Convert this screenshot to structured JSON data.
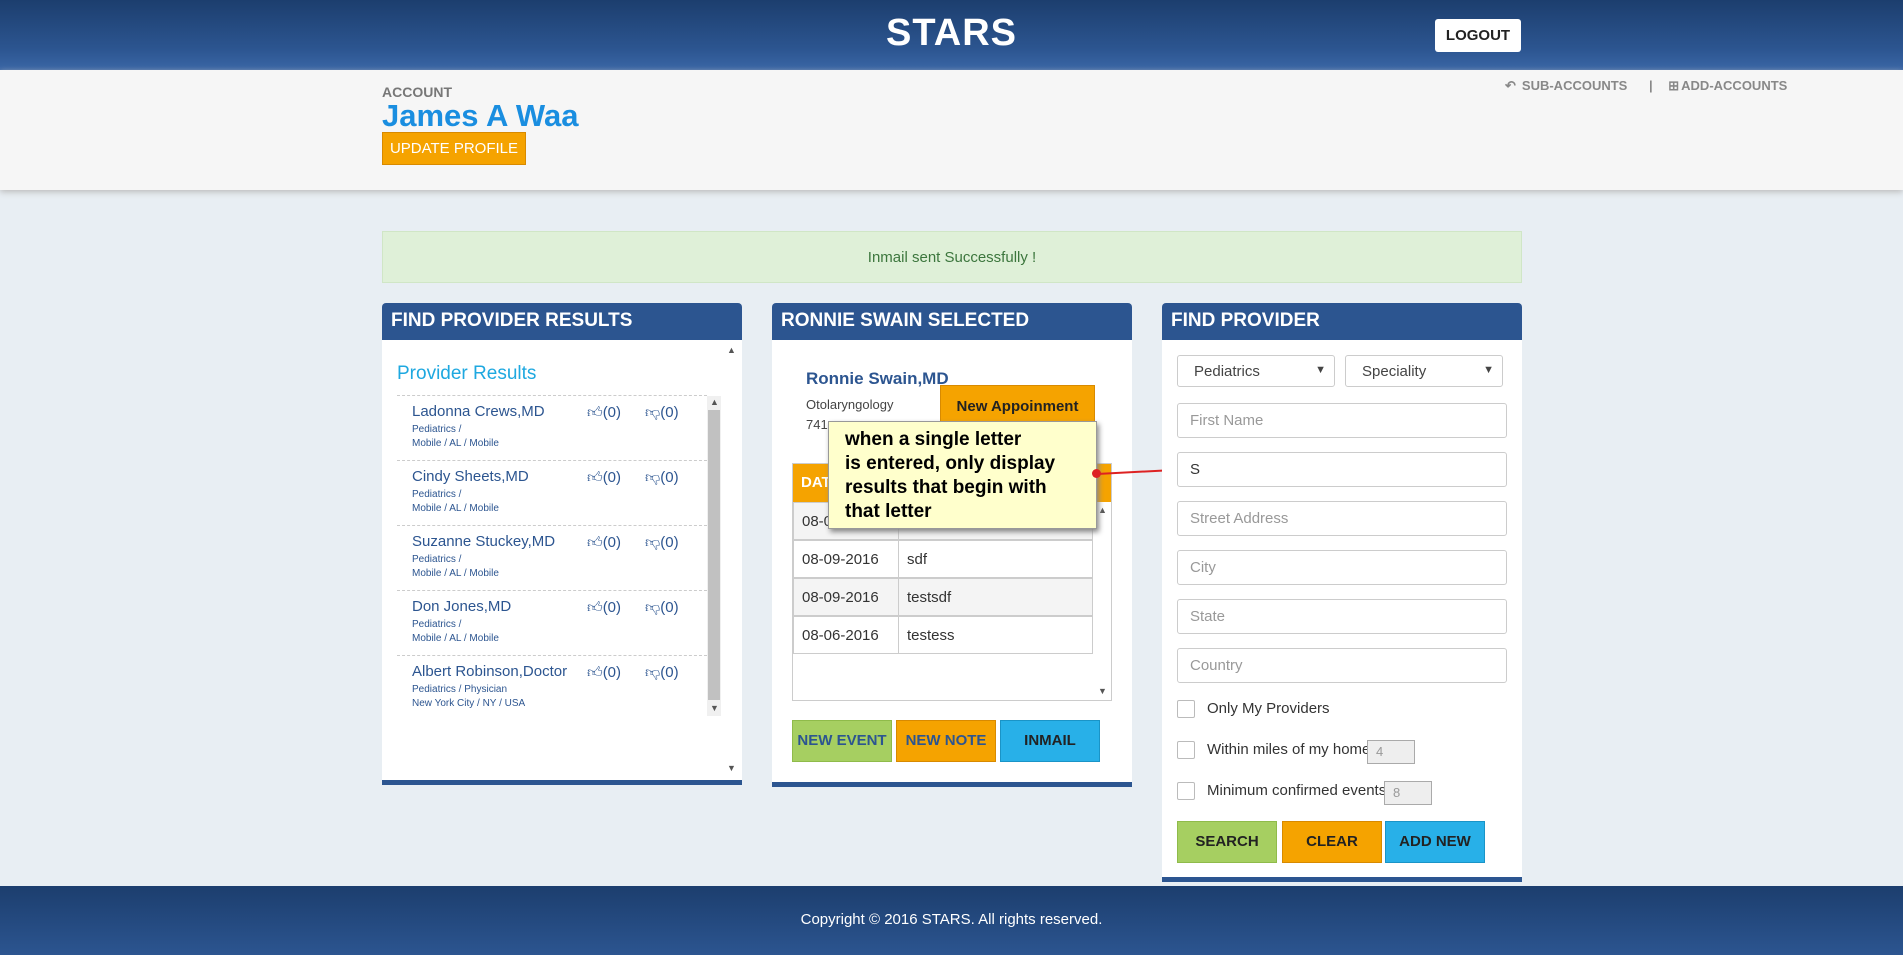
{
  "header": {
    "brand": "STARS",
    "logout_label": "LOGOUT"
  },
  "account": {
    "label": "ACCOUNT",
    "name": "James A Waa",
    "update_label": "UPDATE PROFILE",
    "sub_accounts": "SUB-ACCOUNTS",
    "separator": "|",
    "add_accounts": "ADD-ACCOUNTS"
  },
  "alert": {
    "message": "Inmail sent Successfully !"
  },
  "results": {
    "panel_title": "FIND PROVIDER RESULTS",
    "list_title": "Provider Results",
    "items": [
      {
        "name": "Ladonna Crews,MD",
        "line1": "Pediatrics /",
        "line2": "Mobile / AL / Mobile",
        "up": "(0)",
        "down": "(0)"
      },
      {
        "name": "Cindy Sheets,MD",
        "line1": "Pediatrics /",
        "line2": "Mobile / AL / Mobile",
        "up": "(0)",
        "down": "(0)"
      },
      {
        "name": "Suzanne Stuckey,MD",
        "line1": "Pediatrics /",
        "line2": "Mobile / AL / Mobile",
        "up": "(0)",
        "down": "(0)"
      },
      {
        "name": "Don Jones,MD",
        "line1": "Pediatrics /",
        "line2": "Mobile / AL / Mobile",
        "up": "(0)",
        "down": "(0)"
      },
      {
        "name": "Albert Robinson,Doctor",
        "line1": "Pediatrics / Physician",
        "line2": "New York City / NY / USA",
        "up": "(0)",
        "down": "(0)"
      }
    ]
  },
  "selected": {
    "panel_title": "RONNIE SWAIN SELECTED",
    "doctor_name": "Ronnie Swain,MD",
    "specialty": "Otolaryngology",
    "number_partial": "741",
    "appointment_label": "New Appoinment",
    "table_header": "DAT",
    "rows": [
      {
        "date": "08-0",
        "note": ""
      },
      {
        "date": "08-09-2016",
        "note": "sdf"
      },
      {
        "date": "08-09-2016",
        "note": "testsdf"
      },
      {
        "date": "08-06-2016",
        "note": "testess"
      }
    ],
    "new_event_label": "NEW EVENT",
    "new_note_label": "NEW NOTE",
    "inmail_label": "INMAIL"
  },
  "callout": {
    "line1": "when a single letter",
    "line2": "is entered, only display",
    "line3": "results that begin with",
    "line4": "that letter"
  },
  "find": {
    "panel_title": "FIND PROVIDER",
    "specialty_select": "Pediatrics",
    "speciality_select": "Speciality",
    "first_name_placeholder": "First Name",
    "last_name_value": "S",
    "street_placeholder": "Street Address",
    "city_placeholder": "City",
    "state_placeholder": "State",
    "country_placeholder": "Country",
    "only_my_label": "Only My Providers",
    "miles_label": "Within miles of my home",
    "miles_value": "4",
    "min_events_label": "Minimum confirmed events",
    "min_events_value": "8",
    "search_label": "SEARCH",
    "clear_label": "CLEAR",
    "add_new_label": "ADD NEW"
  },
  "footer": {
    "copyright": "Copyright © 2016 STARS. All rights reserved."
  },
  "colors": {
    "navy": "#2c5590",
    "orange": "#f5a300",
    "green": "#a6cf61",
    "blue": "#28b0e8",
    "link": "#1a8ee0"
  }
}
